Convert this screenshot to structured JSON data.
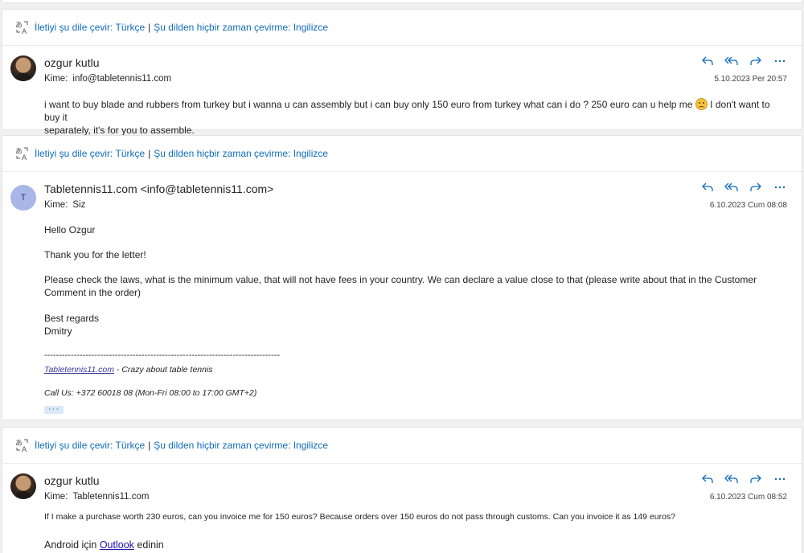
{
  "translate_bar": {
    "translate_link": "İletiyi şu dile çevir: Türkçe",
    "separator": "|",
    "never_link": "Şu dilden hiçbir zaman çevirme: Ingilizce"
  },
  "to_label": "Kime:",
  "messages": [
    {
      "sender": "ozgur kutlu",
      "to": "info@tabletennis11.com",
      "date": "5.10.2023 Per 20:57",
      "body_before_emoji": "i want to buy blade and rubbers from turkey but i wanna u can assembly but i can buy only 150 euro from turkey what can i do ? 250 euro can u help me",
      "body_after_emoji": "I don't want to buy it",
      "body_line2": "separately, it's for you to assemble."
    },
    {
      "sender": "Tabletennis11.com <info@tabletennis11.com>",
      "avatar_initial": "T",
      "to": "Siz",
      "date": "6.10.2023 Cum 08:08",
      "greeting": "Hello Ozgur",
      "thanks": "Thank you for the letter!",
      "para1_line1": "Please check the laws, what is the minimum value, that will not have fees in your country. We can declare a value close to that (please write about that in the Customer",
      "para1_line2": "Comment in the order)",
      "closing": "Best regards",
      "name": "Dmitry",
      "divider": "--------------------------------------------------------------------------------",
      "sig_link": "Tabletennis11.com",
      "sig_tagline": " - Crazy about table tennis",
      "sig_phone": "Call Us: +372 60018 08 (Mon-Fri 08:00 to 17:00 GMT+2)",
      "more": "···"
    },
    {
      "sender": "ozgur kutlu",
      "to": "Tabletennis11.com",
      "date": "6.10.2023 Cum 08:52",
      "body": "If I make a purchase worth 230 euros, can you invoice me for 150 euros? Because orders over 150 euros do not pass through customs. Can you invoice it as 149 euros?",
      "outlook_prefix": "Android için",
      "outlook_link": "Outlook",
      "outlook_suffix": "edinin"
    }
  ],
  "colors": {
    "accent": "#0f6cbd",
    "avatar_bg": "#a8b6e8"
  },
  "icons": [
    "translate-icon",
    "reply-icon",
    "reply-all-icon",
    "forward-icon",
    "more-icon"
  ]
}
